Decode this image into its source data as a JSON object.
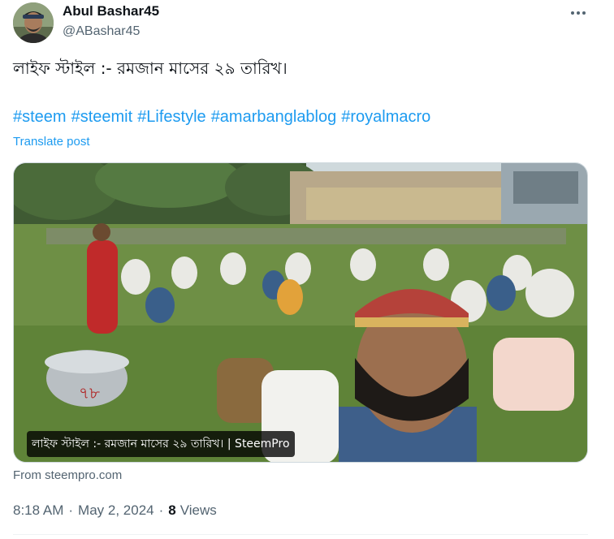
{
  "author": {
    "name": "Abul Bashar45",
    "handle": "@ABashar45",
    "avatar_icon": "user-avatar"
  },
  "more_icon": "more-horizontal-icon",
  "post": {
    "text": "লাইফ স্টাইল :- রমজান মাসের ২৯ তারিখ।",
    "hashtags": [
      "#steem",
      "#steemit",
      "#Lifestyle",
      "#amarbanglablog",
      "#royalmacro"
    ],
    "translate_label": "Translate post"
  },
  "media": {
    "caption": "লাইফ স্টাইল :- রমজান মাসের ২৯ তারিখ। | SteemPro",
    "pot_label": "৭৮",
    "source": "From steempro.com"
  },
  "meta": {
    "time": "8:18 AM",
    "separator": "·",
    "date": "May 2, 2024",
    "views_count": "8",
    "views_label": "Views"
  },
  "colors": {
    "link": "#1d9bf0",
    "secondary_text": "#536471",
    "primary_text": "#0f1419"
  }
}
